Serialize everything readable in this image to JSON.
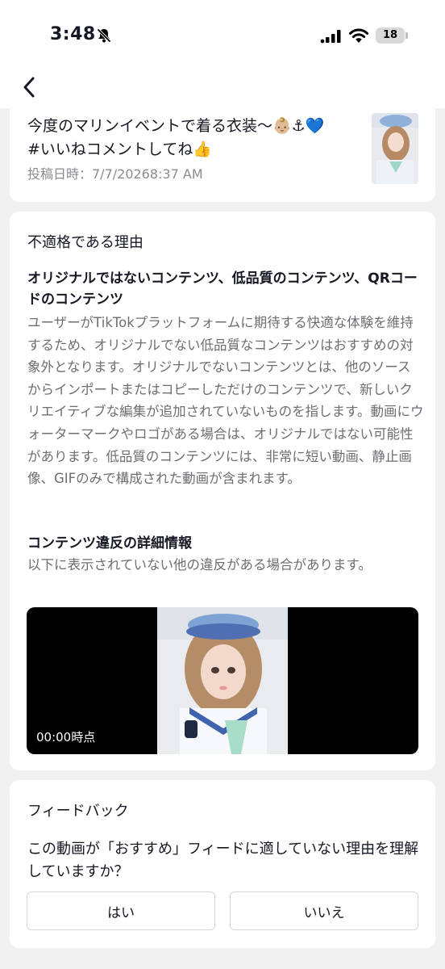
{
  "status_bar": {
    "time": "3:48",
    "battery": "18",
    "icons": [
      "bell-slash-icon",
      "signal-icon",
      "wifi-icon",
      "battery-icon"
    ]
  },
  "nav": {
    "back_icon": "chevron-left-icon"
  },
  "post": {
    "caption_line1": "今度のマリンイベントで着る衣装〜👶🏼⚓💙",
    "caption_line2": "#いいねコメントしてね👍",
    "date": "投稿日時：7/7/20268:37 AM",
    "thumbnail": "post-thumbnail"
  },
  "reason": {
    "title": "不適格である理由",
    "policy_heading": "オリジナルではないコンテンツ、低品質のコンテンツ、QRコードのコンテンツ",
    "policy_body": "ユーザーがTikTokプラットフォームに期待する快適な体験を維持するため、オリジナルでない低品質なコンテンツはおすすめの対象外となります。オリジナルでないコンテンツとは、他のソースからインポートまたはコピーしただけのコンテンツで、新しいクリエイティブな編集が追加されていないものを指します。動画にウォーターマークやロゴがある場合は、オリジナルではない可能性があります。低品質のコンテンツには、非常に短い動画、静止画像、GIFのみで構成された動画が含まれます。",
    "details_heading": "コンテンツ違反の詳細情報",
    "details_body": "以下に表示されていない他の違反がある場合があります。",
    "video_timestamp": "00:00時点"
  },
  "feedback": {
    "title": "フィードバック",
    "question": "この動画が「おすすめ」フィードに適していない理由を理解していますか？",
    "yes_label": "はい",
    "no_label": "いいえ"
  },
  "colors": {
    "background": "#f1f1f2",
    "card": "#ffffff",
    "primary_text": "#161823",
    "secondary_text": "#6d6e74"
  }
}
